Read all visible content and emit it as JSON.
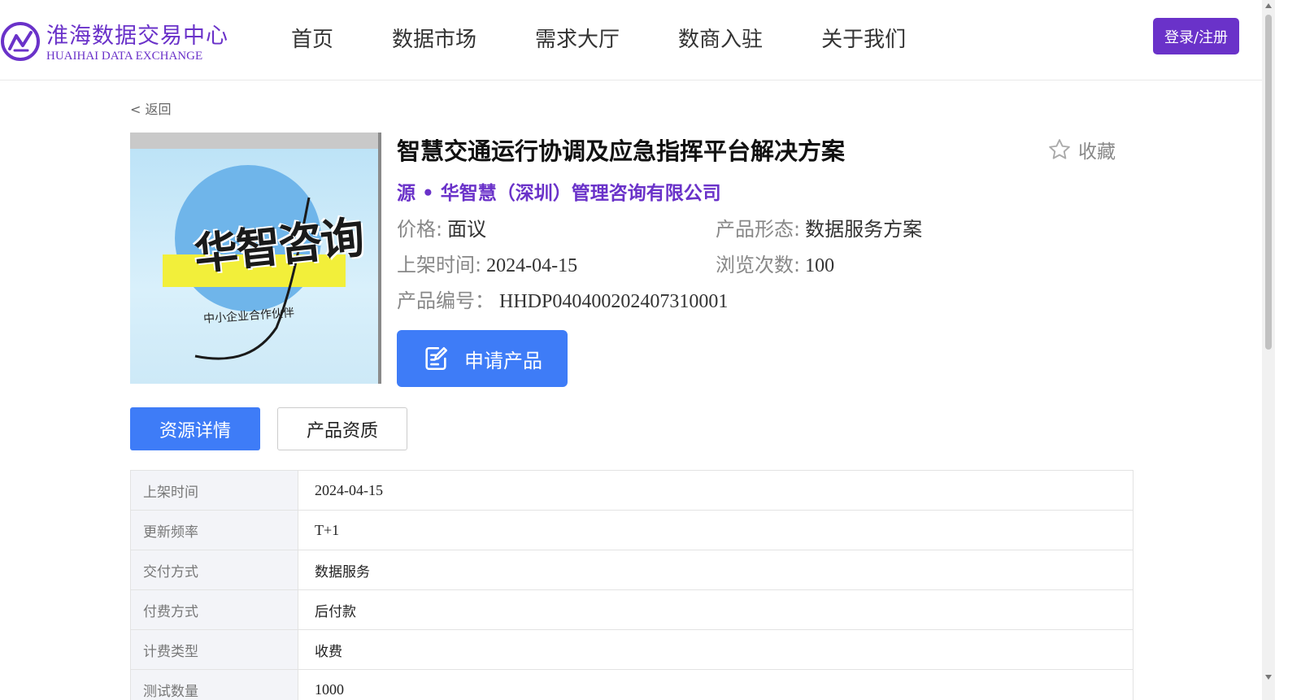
{
  "header": {
    "logo_cn": "淮海数据交易中心",
    "logo_en": "HUAIHAI DATA EXCHANGE",
    "nav": [
      "首页",
      "数据市场",
      "需求大厅",
      "数商入驻",
      "关于我们"
    ],
    "login_label": "登录/注册",
    "brand_color": "#6a32c9"
  },
  "back_label": "< 返回",
  "product": {
    "title": "智慧交通运行协调及应急指挥平台解决方案",
    "favorite_label": "收藏",
    "source": "源 • 华智慧（深圳）管理咨询有限公司",
    "price_label": "价格:",
    "price_value": "面议",
    "form_label": "产品形态:",
    "form_value": "数据服务方案",
    "listed_label": "上架时间:",
    "listed_value": "2024-04-15",
    "views_label": "浏览次数:",
    "views_value": "100",
    "code_label": "产品编号：",
    "code_value": "HHDP040400202407310001",
    "apply_label": "申请产品",
    "image_text": "华智咨询",
    "image_subtext": "中小企业合作伙伴",
    "accent_color": "#3e7cf7"
  },
  "tabs": [
    "资源详情",
    "产品资质"
  ],
  "details": [
    {
      "key": "上架时间",
      "value": "2024-04-15"
    },
    {
      "key": "更新频率",
      "value": "T+1"
    },
    {
      "key": "交付方式",
      "value": "数据服务"
    },
    {
      "key": "付费方式",
      "value": "后付款"
    },
    {
      "key": "计费类型",
      "value": "收费"
    },
    {
      "key": "测试数量",
      "value": "1000"
    }
  ]
}
